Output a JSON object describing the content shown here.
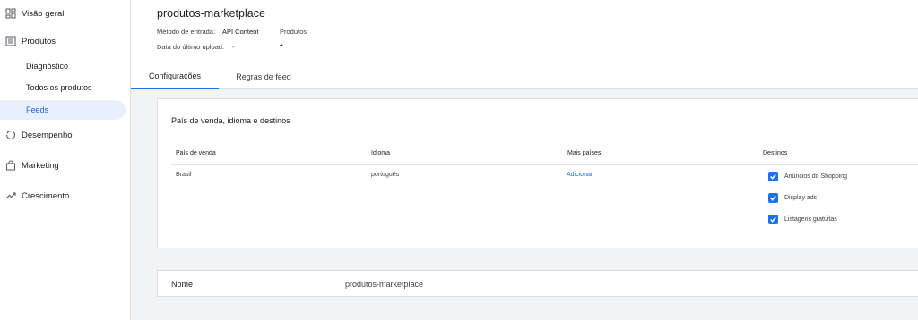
{
  "sidebar": {
    "items": [
      {
        "label": "Visão geral",
        "icon": "dashboard-icon"
      },
      {
        "label": "Produtos",
        "icon": "list-icon"
      },
      {
        "label": "Desempenho",
        "icon": "circle-chart-icon"
      },
      {
        "label": "Marketing",
        "icon": "shopping-bag-icon"
      },
      {
        "label": "Crescimento",
        "icon": "trending-up-icon"
      }
    ],
    "subitems": [
      {
        "label": "Diagnóstico"
      },
      {
        "label": "Todos os produtos"
      },
      {
        "label": "Feeds",
        "active": true
      }
    ]
  },
  "header": {
    "title": "produtos-marketplace",
    "input_method_label": "Método de entrada:",
    "input_method_value": "API Content",
    "products_label": "Produtos",
    "products_value": "-",
    "last_upload_label": "Data do último upload:",
    "last_upload_value": "-"
  },
  "tabs": [
    {
      "label": "Configurações",
      "active": true
    },
    {
      "label": "Regras de feed",
      "active": false
    }
  ],
  "settings_card": {
    "title": "País de venda, idioma e destinos",
    "columns": [
      "País de venda",
      "Idioma",
      "Mais países",
      "Destinos"
    ],
    "row": {
      "country": "Brasil",
      "language": "português",
      "more_countries_link": "Adicionar"
    },
    "destinations": [
      {
        "label": "Anúncios do Shopping",
        "checked": true
      },
      {
        "label": "Display ads",
        "checked": true
      },
      {
        "label": "Listagens gratuitas",
        "checked": true
      }
    ]
  },
  "name_card": {
    "label": "Nome",
    "value": "produtos-marketplace"
  },
  "colors": {
    "accent": "#1a73e8",
    "active_nav_bg": "#e8f0fe",
    "page_bg": "#f1f3f4"
  }
}
